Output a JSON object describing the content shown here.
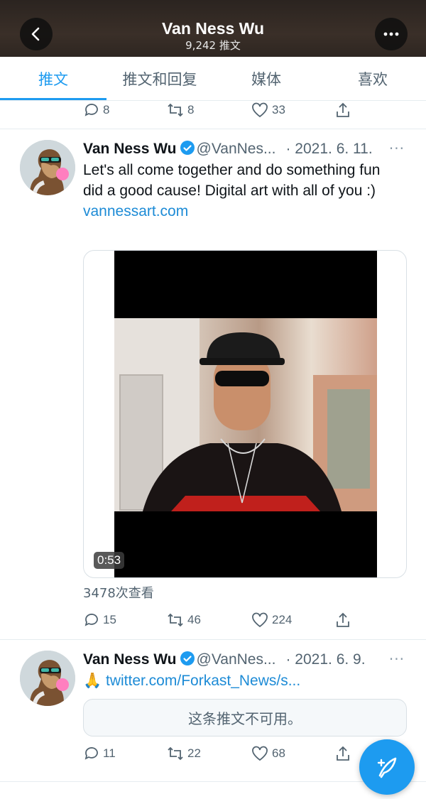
{
  "header": {
    "title": "Van Ness Wu",
    "subtitle": "9,242 推文"
  },
  "tabs": [
    {
      "label": "推文",
      "active": true
    },
    {
      "label": "推文和回复",
      "active": false
    },
    {
      "label": "媒体",
      "active": false
    },
    {
      "label": "喜欢",
      "active": false
    }
  ],
  "prev_tweet_actions": {
    "replies": "8",
    "retweets": "8",
    "likes": "33"
  },
  "tweet1": {
    "name": "Van Ness Wu",
    "handle": "@VanNes...",
    "date": "· 2021. 6. 11.",
    "text": "Let's all come together and do something fun did a good cause! Digital art with all of you :)",
    "link": "vannessart.com",
    "video_duration": "0:53",
    "views": "3478次查看",
    "replies": "15",
    "retweets": "46",
    "likes": "224"
  },
  "tweet2": {
    "name": "Van Ness Wu",
    "handle": "@VanNes...",
    "date": "· 2021. 6. 9.",
    "emoji": "🙏",
    "link": "twitter.com/Forkast_News/s...",
    "quote_unavailable": "这条推文不可用。",
    "replies": "11",
    "retweets": "22",
    "likes": "68"
  },
  "more_glyph": "···",
  "colors": {
    "accent": "#1d9bf0",
    "secondary_text": "#536471"
  }
}
